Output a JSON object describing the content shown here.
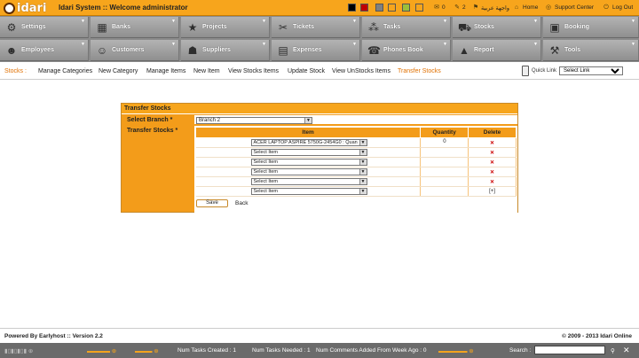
{
  "app": {
    "name": "idari",
    "title": "Idari System :: Welcome administrator"
  },
  "colors": {
    "accent": "#f7a51c",
    "nav_bg": "#8a8a8a",
    "active_link": "#e07000",
    "swatches": [
      "#000000",
      "#c00000",
      "#808080",
      "#f7a51c",
      "#9bbf3a",
      "#f7a51c",
      "#d99a2a"
    ]
  },
  "topbar": {
    "mail_count": "0",
    "tasks_count": "2",
    "arabic_label": "واجهة عربية",
    "home": "Home",
    "support": "Support Center",
    "logout": "Log Out"
  },
  "nav": {
    "row1": [
      {
        "label": "Settings",
        "icon": "wrench-icon"
      },
      {
        "label": "Banks",
        "icon": "bank-icon"
      },
      {
        "label": "Projects",
        "icon": "star-icon"
      },
      {
        "label": "Tickets",
        "icon": "ticket-icon"
      },
      {
        "label": "Tasks",
        "icon": "tasks-icon"
      },
      {
        "label": "Stocks",
        "icon": "truck-icon"
      },
      {
        "label": "Booking",
        "icon": "booking-icon"
      }
    ],
    "row2": [
      {
        "label": "Employees",
        "icon": "employees-icon"
      },
      {
        "label": "Customers",
        "icon": "customers-icon"
      },
      {
        "label": "Suppliers",
        "icon": "suppliers-icon"
      },
      {
        "label": "Expenses",
        "icon": "briefcase-icon"
      },
      {
        "label": "Phones Book",
        "icon": "phone-icon"
      },
      {
        "label": "Report",
        "icon": "report-icon"
      },
      {
        "label": "Tools",
        "icon": "tools-icon"
      }
    ]
  },
  "subnav": {
    "lead": "Stocks :",
    "links": [
      "Manage Categories",
      "New Category",
      "Manage Items",
      "New Item",
      "View Stocks Items",
      "Update Stock",
      "View UnStocks Items",
      "Transfer Stocks"
    ],
    "quick_label": "Quick Link",
    "quick_value": "Select Link"
  },
  "form": {
    "title": "Transfer Stocks",
    "branch_label": "Select Branch *",
    "branch_value": "Branch 2",
    "stocks_label": "Transfer Stocks *",
    "columns": [
      "Item",
      "Quantity",
      "Delete"
    ],
    "rows": [
      {
        "item": "ACER LAPTOP ASPIRE 5750G-2454G0 : Quan",
        "qty": "0"
      },
      {
        "item": "Select Item",
        "qty": ""
      },
      {
        "item": "Select Item",
        "qty": ""
      },
      {
        "item": "Select Item",
        "qty": ""
      },
      {
        "item": "Select Item",
        "qty": ""
      },
      {
        "item": "Select Item",
        "qty": ""
      }
    ],
    "add_label": "[+]",
    "save": "Save",
    "back": "Back"
  },
  "footer": {
    "left": "Powered By Earlyhost :: Version 2.2",
    "right": "© 2009 - 2013 Idari Online"
  },
  "statusbar": {
    "items": [
      "Num Tasks Created : 1",
      "Num Tasks Needed : 1",
      "Num Comments Added From Week Ago : 0"
    ],
    "search_label": "Search :"
  }
}
